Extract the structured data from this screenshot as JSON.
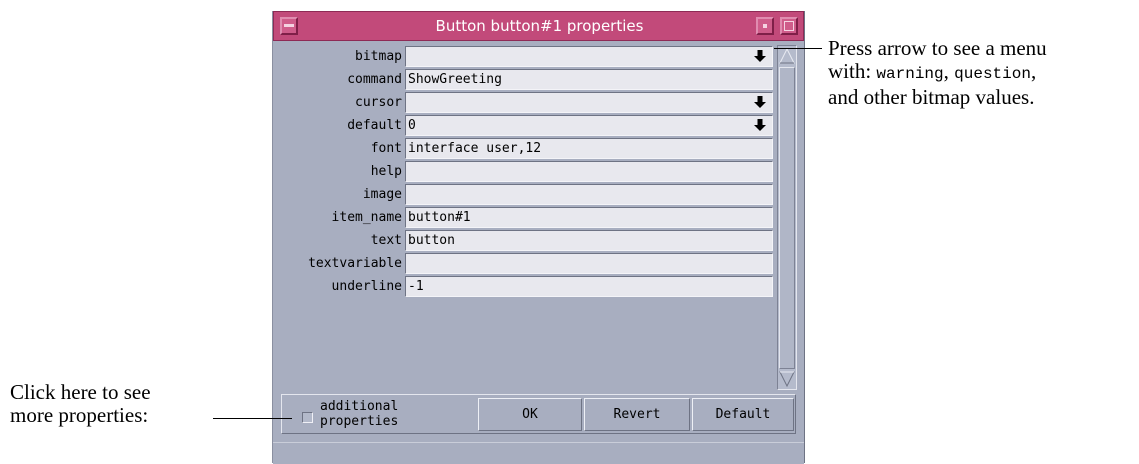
{
  "window": {
    "title": "Button button#1 properties"
  },
  "properties": [
    {
      "label": "bitmap",
      "value": "",
      "has_menu": true
    },
    {
      "label": "command",
      "value": "ShowGreeting",
      "has_menu": false
    },
    {
      "label": "cursor",
      "value": "",
      "has_menu": true
    },
    {
      "label": "default",
      "value": "0",
      "has_menu": true
    },
    {
      "label": "font",
      "value": "interface user,12",
      "has_menu": false
    },
    {
      "label": "help",
      "value": "",
      "has_menu": false
    },
    {
      "label": "image",
      "value": "",
      "has_menu": false
    },
    {
      "label": "item_name",
      "value": "button#1",
      "has_menu": false
    },
    {
      "label": "text",
      "value": "button",
      "has_menu": false
    },
    {
      "label": "textvariable",
      "value": "",
      "has_menu": false
    },
    {
      "label": "underline",
      "value": "-1",
      "has_menu": false
    }
  ],
  "bottom": {
    "checkbox_label_line1": "additional",
    "checkbox_label_line2": "properties",
    "ok_label": "OK",
    "revert_label": "Revert",
    "default_label": "Default"
  },
  "annotations": {
    "arrow_note_line1": "Press arrow to see a menu",
    "arrow_note_with": "with: ",
    "arrow_note_code1": "warning",
    "arrow_note_sep": ", ",
    "arrow_note_code2": "question",
    "arrow_note_tail": ",",
    "arrow_note_line3": "and other bitmap values.",
    "checkbox_note_line1": "Click here to see",
    "checkbox_note_line2": "more properties:"
  }
}
